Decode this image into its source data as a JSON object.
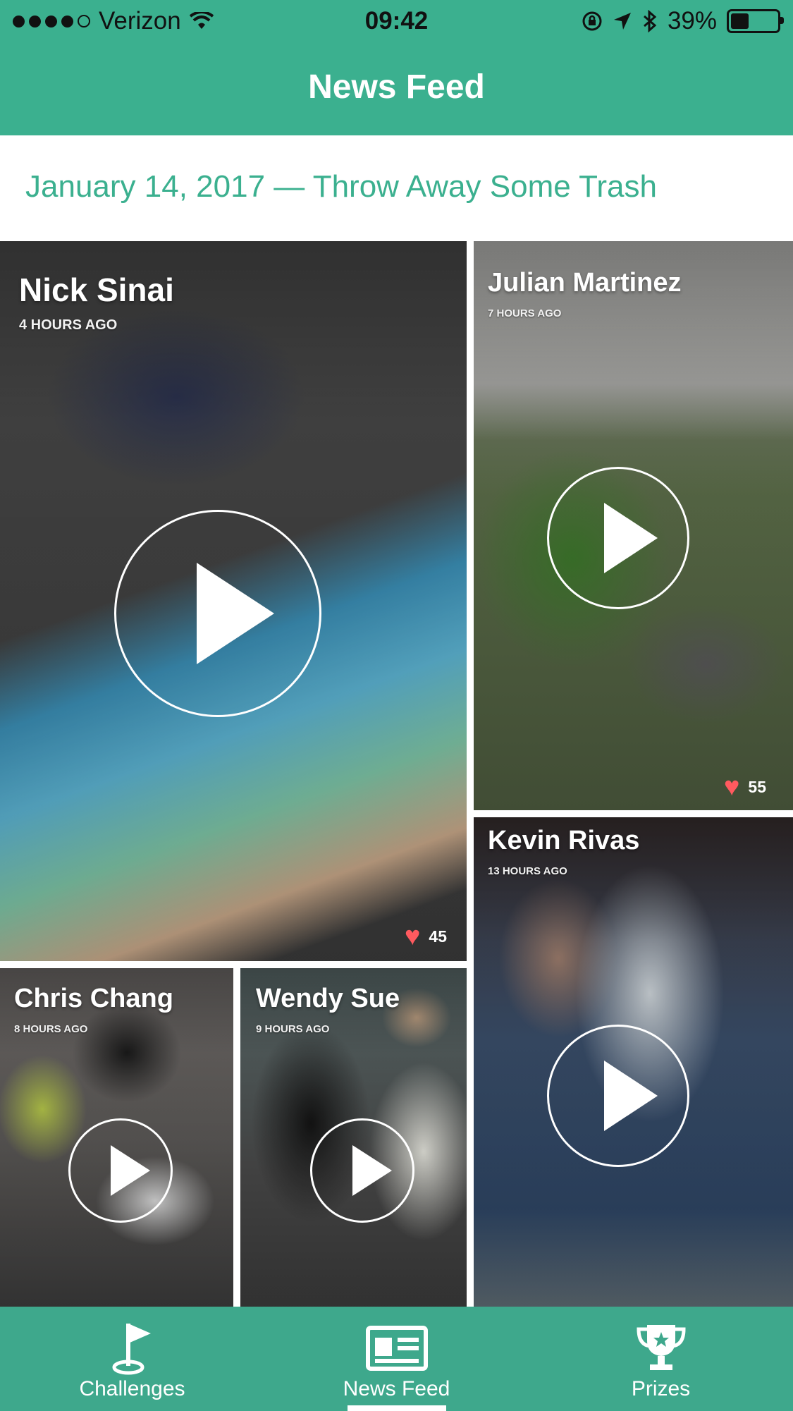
{
  "status_bar": {
    "carrier": "Verizon",
    "time": "09:42",
    "battery": "39%"
  },
  "nav": {
    "title": "News Feed"
  },
  "feed": {
    "header": "January 14, 2017 — Throw Away Some Trash",
    "posts": [
      {
        "name": "Nick Sinai",
        "time": "4 HOURS AGO",
        "likes": "45"
      },
      {
        "name": "Julian Martinez",
        "time": "7 HOURS AGO",
        "likes": "55"
      },
      {
        "name": "Kevin Rivas",
        "time": "13 HOURS AGO"
      },
      {
        "name": "Chris Chang",
        "time": "8 HOURS AGO"
      },
      {
        "name": "Wendy Sue",
        "time": "9 HOURS AGO"
      }
    ]
  },
  "tab_bar": {
    "tabs": [
      {
        "label": "Challenges",
        "icon": "golf-flag-icon"
      },
      {
        "label": "News Feed",
        "icon": "newspaper-icon",
        "selected": true
      },
      {
        "label": "Prizes",
        "icon": "trophy-icon"
      }
    ]
  },
  "colors": {
    "accent": "#3bb08f",
    "heart": "#ff5a5f"
  }
}
